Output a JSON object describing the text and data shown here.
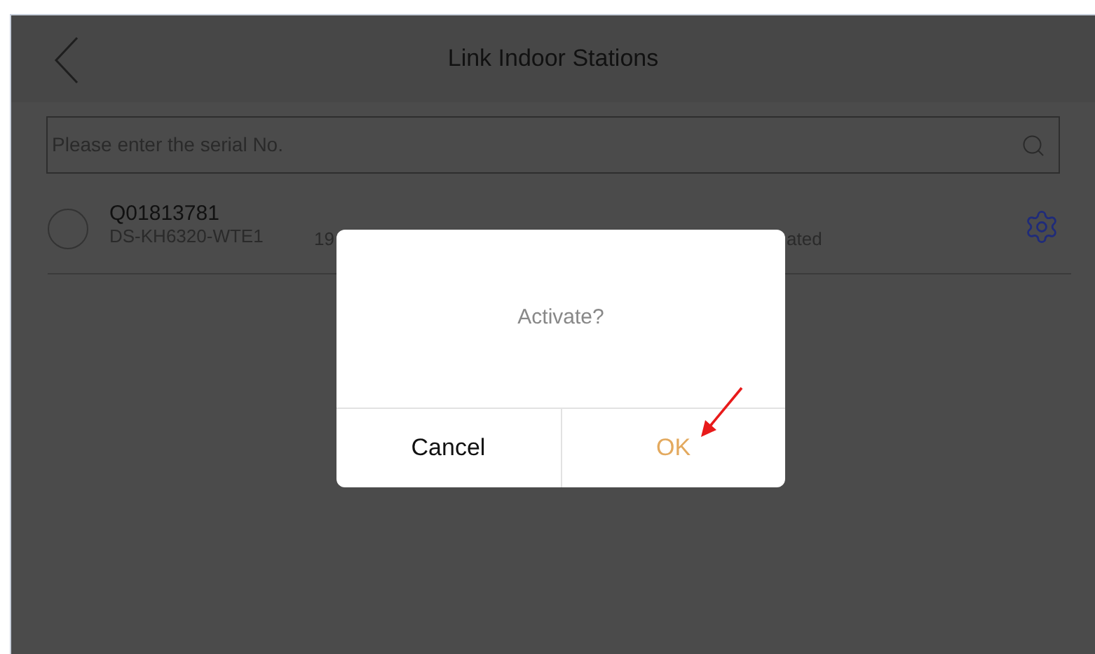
{
  "header": {
    "title": "Link Indoor Stations"
  },
  "search": {
    "placeholder": "Please enter the serial No."
  },
  "stations": [
    {
      "selected": false,
      "serial": "Q01813781",
      "model": "DS-KH6320-WTE1",
      "column_3": "19",
      "column_4": "ated"
    }
  ],
  "dialog": {
    "message": "Activate?",
    "buttons": [
      {
        "label": "Cancel",
        "kind": "cancel"
      },
      {
        "label": "OK",
        "kind": "confirm"
      }
    ]
  }
}
